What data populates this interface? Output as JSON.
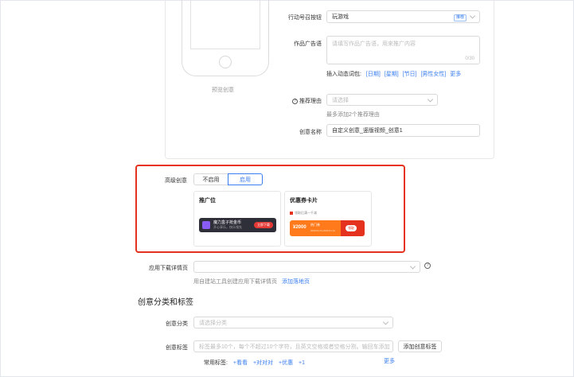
{
  "preview": {
    "label": "预览创意"
  },
  "action_button": {
    "label": "行动号召按钮",
    "value": "玩游戏",
    "badge": "推荐"
  },
  "ad_copy": {
    "label": "作品广告语",
    "placeholder": "请填写作品广告语，用来推广内容",
    "counter": "0/30"
  },
  "insert_words": {
    "label": "插入动态词包:",
    "words": [
      "[日期]",
      "[星期]",
      "[节日]",
      "[男性女性]"
    ],
    "more": "更多"
  },
  "recommend_reason": {
    "label": "推荐理由",
    "placeholder": "请选择",
    "hint": "最多添加2个推荐理由"
  },
  "creative_name": {
    "label": "创意名称",
    "value": "自定义创意_竖版视频_创意1"
  },
  "advanced": {
    "label": "高级创意",
    "options": [
      "不启用",
      "启用"
    ],
    "selected": "启用",
    "cards": [
      {
        "title": "推广位",
        "promo_title": "魔力盒子抢金币",
        "promo_sub": "开心享乐，快乐领先",
        "promo_button": "立即下载"
      },
      {
        "title": "优惠券卡片",
        "coupon_top": "领取后满一千减",
        "price": "¥2000",
        "coupon_name": "热门券",
        "coupon_date": "2020.01.01-2020.01.31",
        "coupon_button": "领取"
      }
    ]
  },
  "download_page": {
    "label": "应用下载详情页",
    "hint": "用自建站工具创建应用下载详情页",
    "link": "添加落地页"
  },
  "section": {
    "title": "创意分类和标签"
  },
  "category": {
    "label": "创意分类",
    "placeholder": "请选择分类"
  },
  "tags": {
    "label": "创意标签",
    "placeholder": "标签最多10个，每个不超过10个字符，且英文空格或者空格分割。输回车添加",
    "add_button": "添加创意标签",
    "common_label": "常用标签:",
    "common": [
      "+看看",
      "+对对对",
      "+优惠",
      "+1"
    ],
    "more": "更多"
  },
  "colors": {
    "accent": "#3a7ef0",
    "highlight_border": "#e5321e"
  }
}
